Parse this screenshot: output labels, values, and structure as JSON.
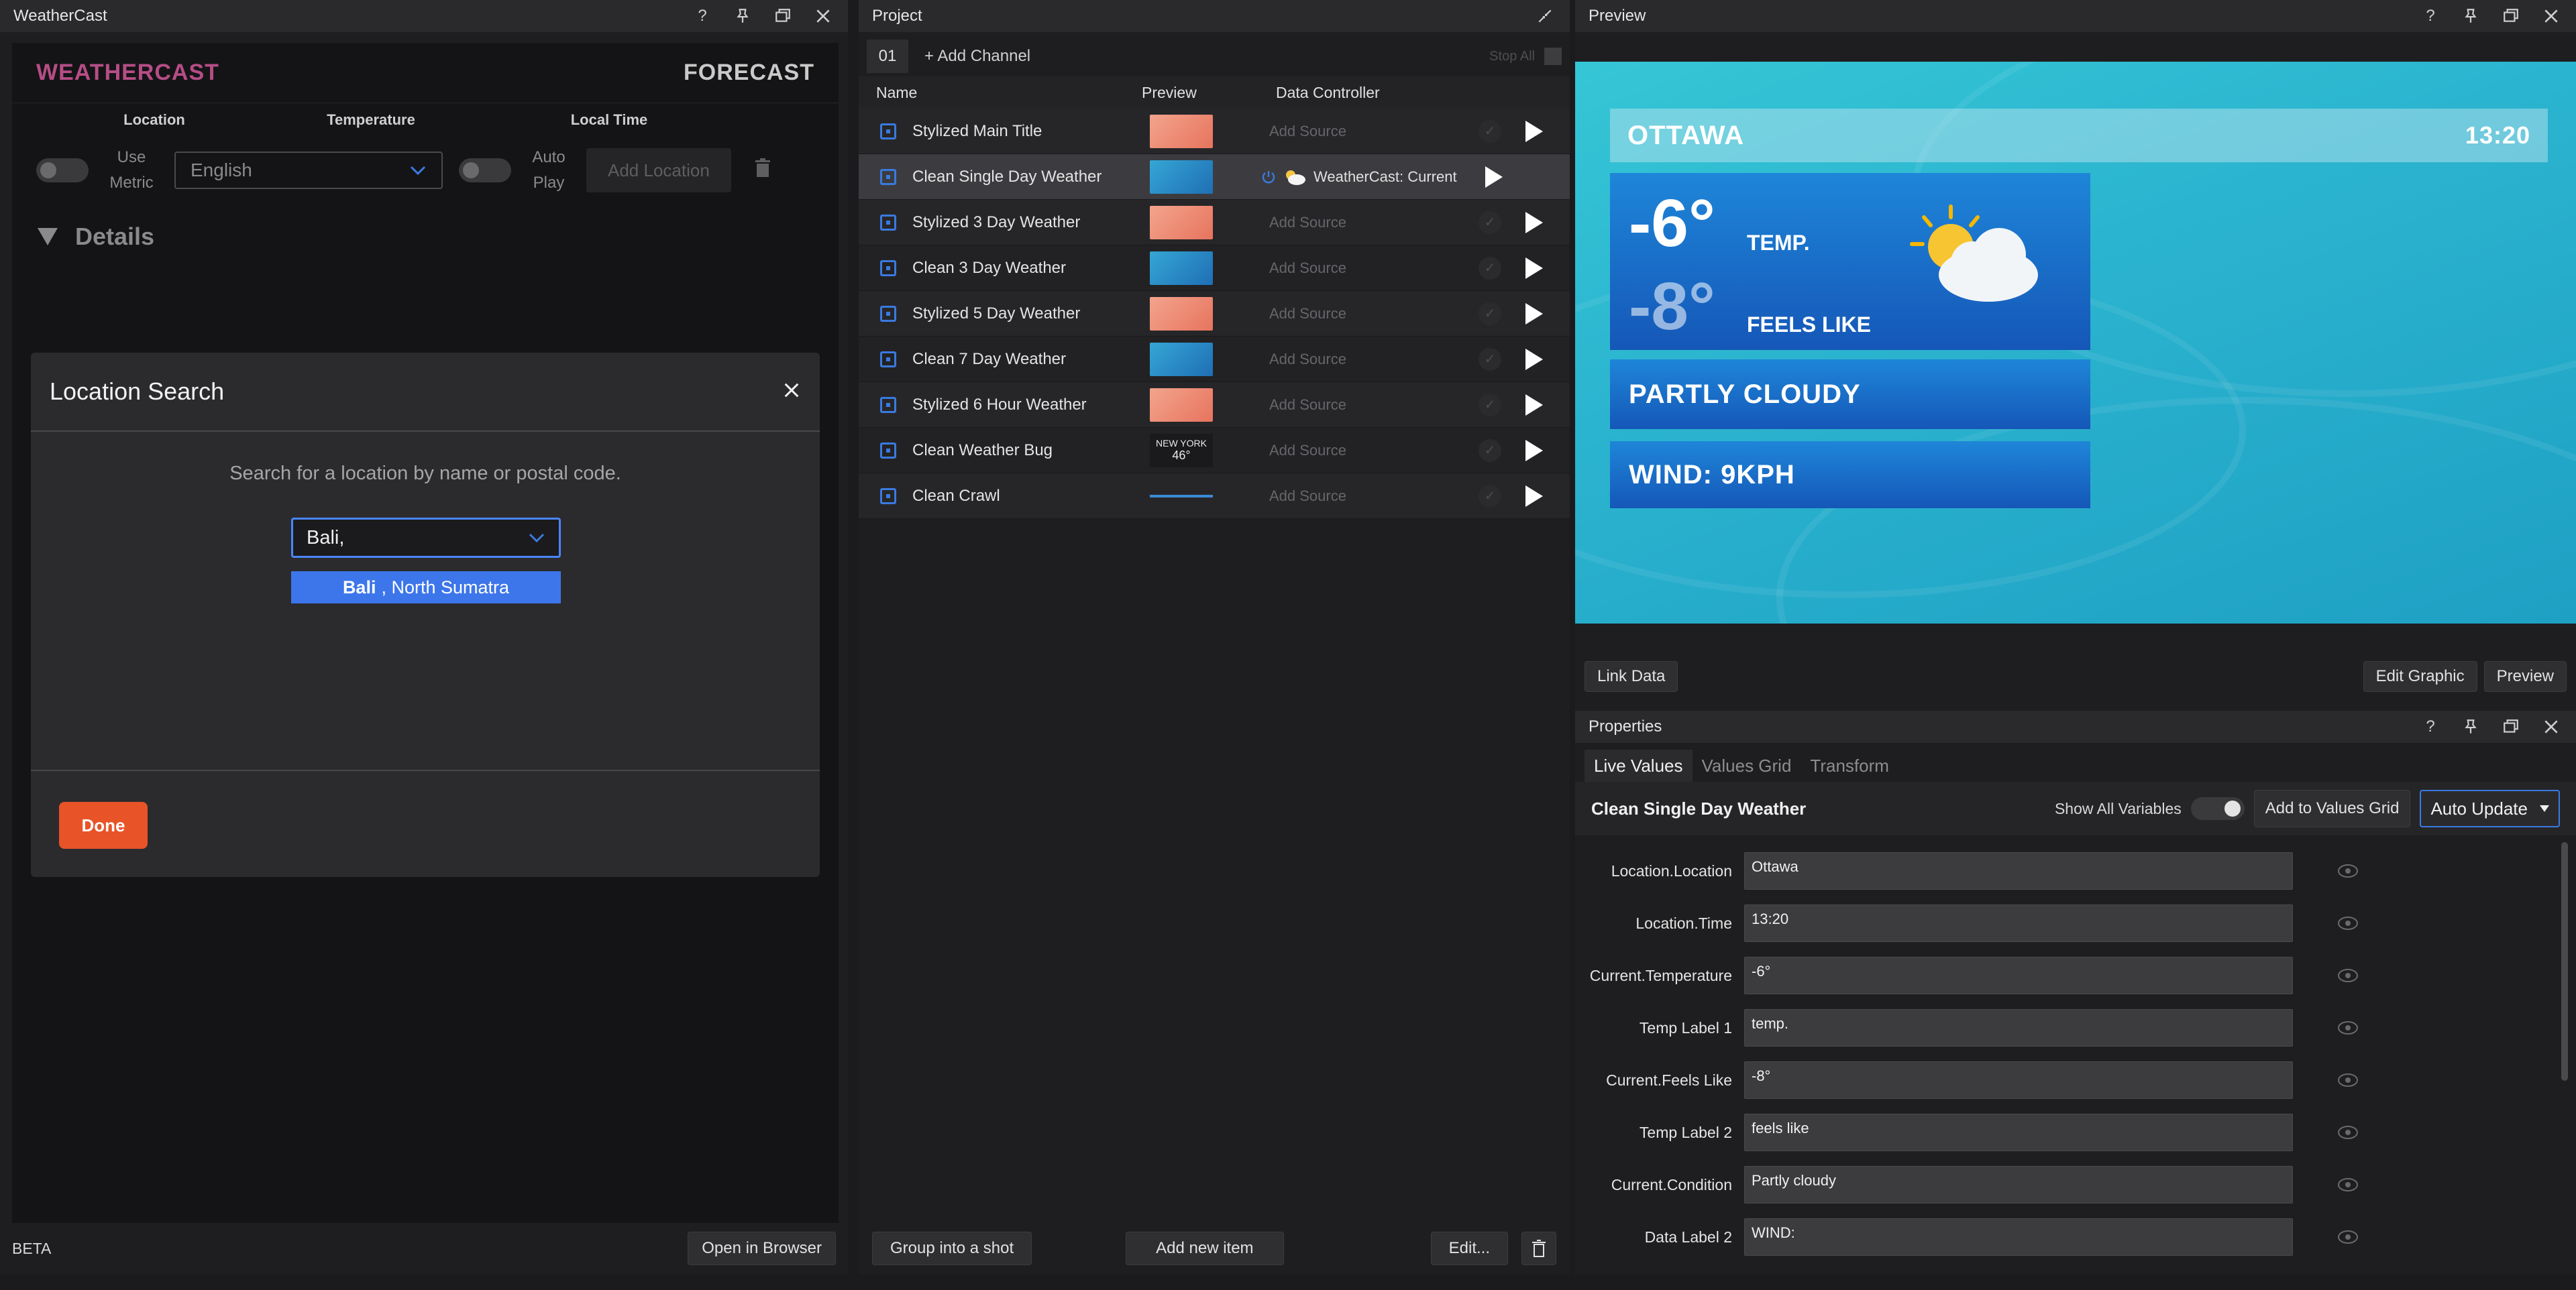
{
  "left_panel": {
    "title": "WeatherCast",
    "logo": "WEATHERCAST",
    "forecast": "FORECAST",
    "columns": [
      "Location",
      "Temperature",
      "Local Time"
    ],
    "use_metric": "Use Metric",
    "language_value": "English",
    "auto_play": "Auto Play",
    "add_location": "Add Location",
    "details": "Details",
    "beta": "BETA",
    "open_in_browser": "Open in Browser"
  },
  "modal": {
    "title": "Location Search",
    "hint": "Search for a location by name or postal code.",
    "input_value": "Bali,",
    "suggestion_bold": "Bali",
    "suggestion_rest": ", North Sumatra",
    "done": "Done"
  },
  "project": {
    "title": "Project",
    "channel_tab": "01",
    "add_channel": "+ Add Channel",
    "stop_all": "Stop All",
    "headers": {
      "name": "Name",
      "preview": "Preview",
      "data_controller": "Data Controller"
    },
    "rows": [
      {
        "name": "Stylized Main Title",
        "source": "Add Source"
      },
      {
        "name": "Clean Single Day Weather",
        "source": "WeatherCast: Current"
      },
      {
        "name": "Stylized 3 Day Weather",
        "source": "Add Source"
      },
      {
        "name": "Clean 3 Day Weather",
        "source": "Add Source"
      },
      {
        "name": "Stylized 5 Day Weather",
        "source": "Add Source"
      },
      {
        "name": "Clean 7 Day Weather",
        "source": "Add Source"
      },
      {
        "name": "Stylized 6 Hour Weather",
        "source": "Add Source"
      },
      {
        "name": "Clean Weather Bug",
        "source": "Add Source"
      },
      {
        "name": "Clean Crawl",
        "source": "Add Source"
      }
    ],
    "bug_thumb_city": "NEW YORK",
    "bug_thumb_temp": "46°",
    "group_into_shot": "Group into a shot",
    "add_new_item": "Add new item",
    "edit": "Edit..."
  },
  "preview": {
    "title": "Preview",
    "city": "OTTAWA",
    "time": "13:20",
    "temp": "-6°",
    "temp_label": "TEMP.",
    "feels": "-8°",
    "feels_label": "FEELS LIKE",
    "condition": "PARTLY CLOUDY",
    "wind": "WIND: 9KPH",
    "link_data": "Link Data",
    "edit_graphic": "Edit Graphic",
    "preview_btn": "Preview"
  },
  "properties": {
    "title": "Properties",
    "tabs": [
      "Live Values",
      "Values Grid",
      "Transform"
    ],
    "item_name": "Clean Single Day Weather",
    "show_all_variables": "Show All Variables",
    "add_to_values_grid": "Add to Values Grid",
    "auto_update": "Auto Update",
    "variables": [
      {
        "label": "Location.Location",
        "value": "Ottawa"
      },
      {
        "label": "Location.Time",
        "value": "13:20"
      },
      {
        "label": "Current.Temperature",
        "value": "-6°"
      },
      {
        "label": "Temp Label 1",
        "value": "temp."
      },
      {
        "label": "Current.Feels Like",
        "value": "-8°"
      },
      {
        "label": "Temp Label 2",
        "value": "feels like"
      },
      {
        "label": "Current.Condition",
        "value": "Partly cloudy"
      },
      {
        "label": "Data Label 2",
        "value": "WIND:"
      }
    ]
  }
}
